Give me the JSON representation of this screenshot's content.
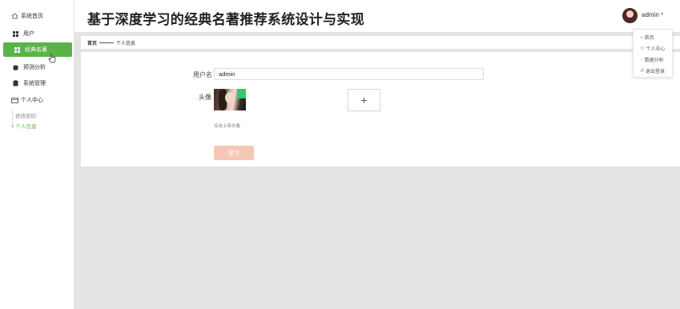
{
  "header": {
    "title": "基于深度学习的经典名著推荐系统设计与实现",
    "user_name": "admin",
    "caret": "▾"
  },
  "sidebar": {
    "home": "系统首页",
    "items": [
      {
        "label": "用户"
      },
      {
        "label": "经典名著"
      },
      {
        "label": "预测分析"
      },
      {
        "label": "系统管理"
      }
    ],
    "user_center": "个人中心",
    "sub_items": [
      {
        "label": "修改密码"
      },
      {
        "label": "+ 个人信息"
      }
    ]
  },
  "dropdown": {
    "items": [
      {
        "icon": "home-icon",
        "label": "首页"
      },
      {
        "icon": "user-icon",
        "label": "个人中心"
      },
      {
        "icon": "chat-icon",
        "label": "数据分析"
      },
      {
        "icon": "logout-icon",
        "label": "退出登录"
      }
    ]
  },
  "breadcrumb": {
    "home": "首页",
    "current": "个人信息"
  },
  "form": {
    "username_label": "用户名",
    "username_value": "admin",
    "avatar_label": "头像",
    "upload_plus": "+",
    "upload_hint": "点击上传头像",
    "submit_label": "提交"
  },
  "colors": {
    "accent": "#5bb24a",
    "submit": "#f5c7b6",
    "background": "#e4e4e4"
  }
}
